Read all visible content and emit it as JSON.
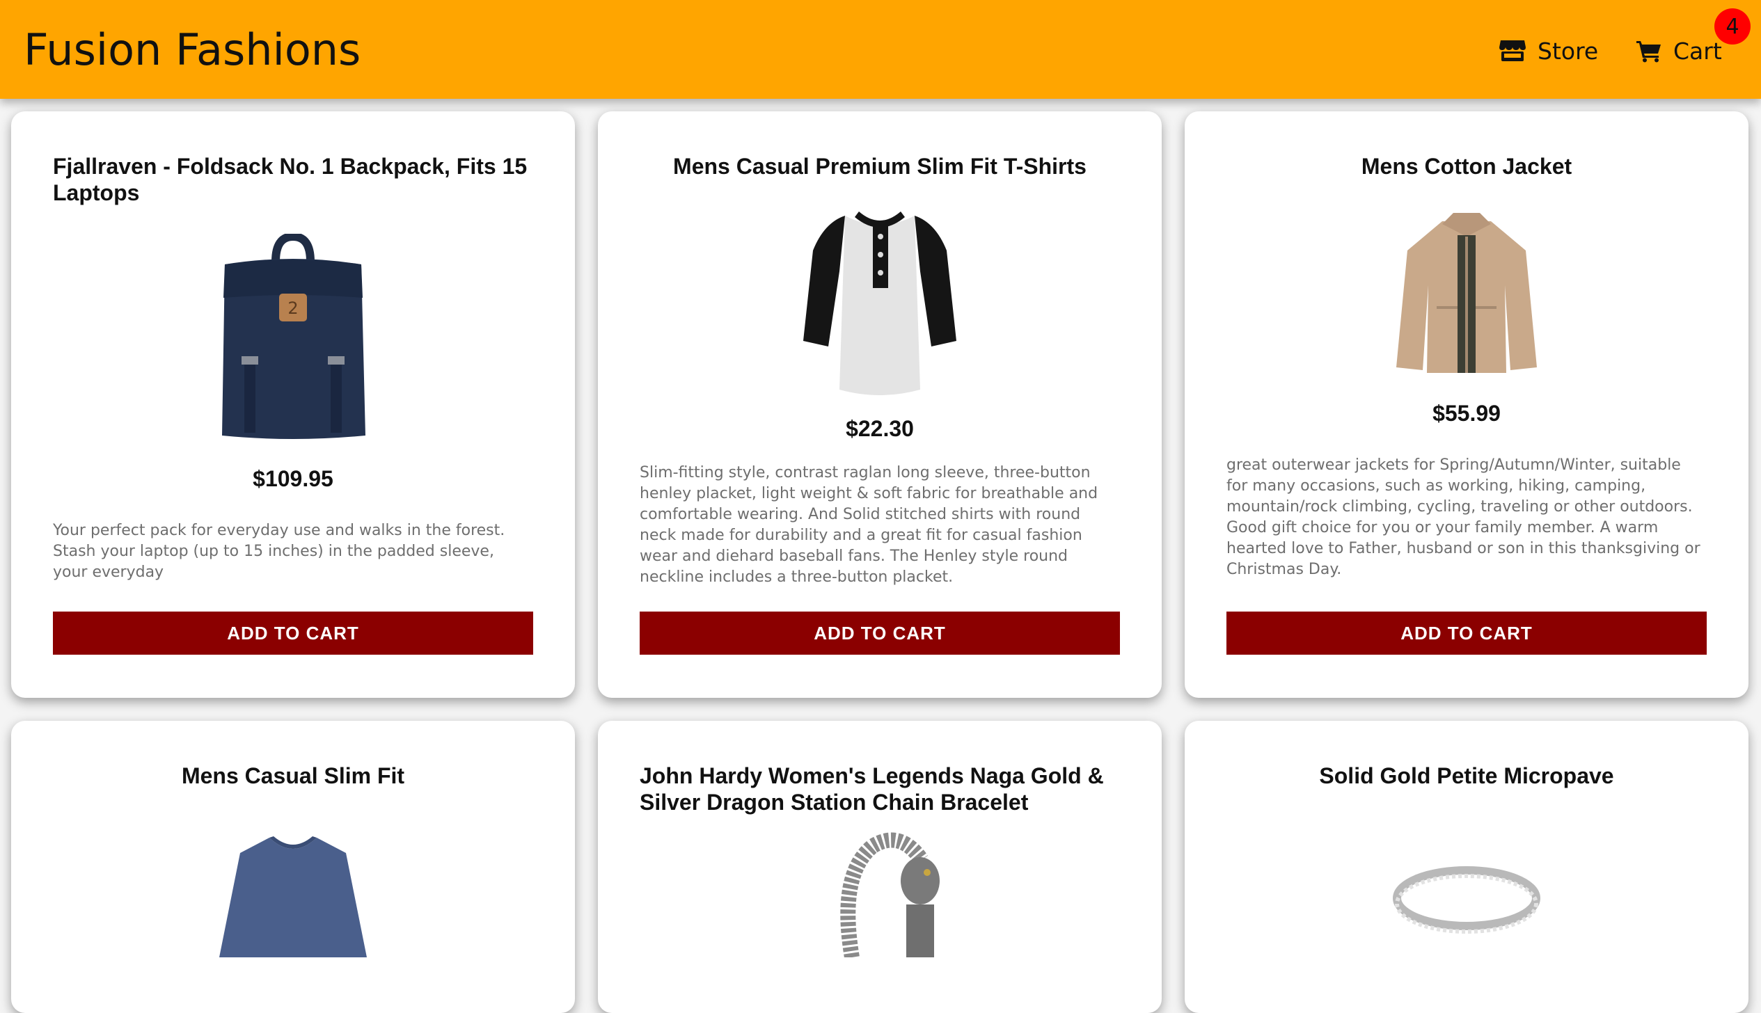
{
  "header": {
    "brand": "Fusion Fashions",
    "nav": {
      "store_label": "Store",
      "cart_label": "Cart"
    },
    "cart_count": "4",
    "colors": {
      "background": "#ffa500",
      "badge": "#ff0000"
    },
    "icons": {
      "store": "store-icon",
      "cart": "shopping-cart-icon"
    }
  },
  "products": [
    {
      "title": "Fjallraven - Foldsack No. 1 Backpack, Fits 15 Laptops",
      "price": "$109.95",
      "description": "Your perfect pack for everyday use and walks in the forest. Stash your laptop (up to 15 inches) in the padded sleeve, your everyday",
      "button": "ADD TO CART",
      "image": "backpack-image"
    },
    {
      "title": "Mens Casual Premium Slim Fit T-Shirts",
      "price": "$22.30",
      "description": "Slim-fitting style, contrast raglan long sleeve, three-button henley placket, light weight & soft fabric for breathable and comfortable wearing. And Solid stitched shirts with round neck made for durability and a great fit for casual fashion wear and diehard baseball fans. The Henley style round neckline includes a three-button placket.",
      "button": "ADD TO CART",
      "image": "raglan-shirt-image"
    },
    {
      "title": "Mens Cotton Jacket",
      "price": "$55.99",
      "description": "great outerwear jackets for Spring/Autumn/Winter, suitable for many occasions, such as working, hiking, camping, mountain/rock climbing, cycling, traveling or other outdoors. Good gift choice for you or your family member. A warm hearted love to Father, husband or son in this thanksgiving or Christmas Day.",
      "button": "ADD TO CART",
      "image": "jacket-image"
    },
    {
      "title": "Mens Casual Slim Fit",
      "image": "blue-sweater-image"
    },
    {
      "title": "John Hardy Women's Legends Naga Gold & Silver Dragon Station Chain Bracelet",
      "image": "dragon-bracelet-image"
    },
    {
      "title": "Solid Gold Petite Micropave",
      "image": "ring-image"
    }
  ],
  "colors": {
    "button": "#8b0000",
    "price_text": "#111111",
    "description_text": "#6e6e6e"
  }
}
